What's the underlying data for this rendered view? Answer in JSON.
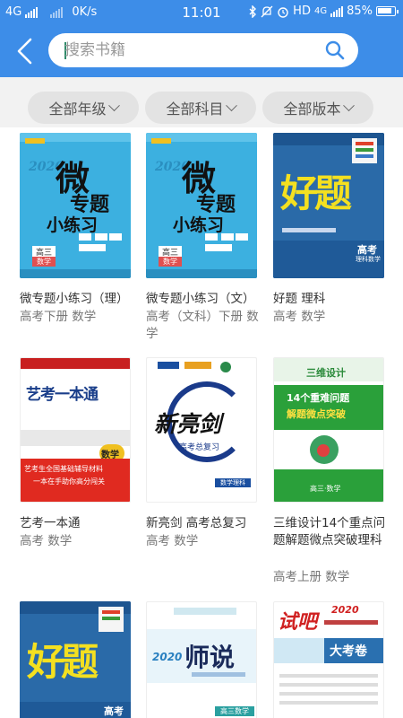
{
  "status_bar": {
    "network_left": "4G",
    "speed": "0K/s",
    "time": "11:01",
    "hd_label": "HD",
    "network_right": "4G",
    "battery": "85%"
  },
  "search": {
    "placeholder": "搜索书籍"
  },
  "filters": [
    {
      "label": "全部年级"
    },
    {
      "label": "全部科目"
    },
    {
      "label": "全部版本"
    }
  ],
  "books": [
    {
      "title": "微专题小练习（理）",
      "meta": "高考下册 数学"
    },
    {
      "title": "微专题小练习（文）",
      "meta": "高考（文科）下册 数学"
    },
    {
      "title": "好题 理科",
      "meta": "高考 数学"
    },
    {
      "title": "艺考一本通",
      "meta": "高考 数学"
    },
    {
      "title": "新亮剑 高考总复习",
      "meta": "高考 数学"
    },
    {
      "title": "三维设计14个重点问题解题微点突破理科",
      "meta": "高考上册 数学"
    }
  ],
  "covers": {
    "c1": {
      "main": "微",
      "sub": "专题",
      "small": "小练习",
      "year": "2020",
      "badge": "高三",
      "subject": "数学"
    },
    "c2": {
      "main": "微",
      "sub": "专题",
      "small": "小练习",
      "year": "2020",
      "badge": "高三",
      "subject": "数学"
    },
    "c3": {
      "main": "好题",
      "tag": "高考",
      "tag2": "理科数学"
    },
    "c4": {
      "main": "艺考一本通",
      "subject": "数学",
      "line1": "艺考生全国基础辅导材料",
      "line2": "一本在手助你高分闯关"
    },
    "c5": {
      "main": "新亮剑",
      "line1": "高考总复习",
      "tag": "数学理科"
    },
    "c6": {
      "top": "三维设计",
      "line1": "14个重难问题",
      "line2": "解题微点突破",
      "bottom": "高三·数学"
    },
    "c7": {
      "main": "好题",
      "tag": "高考"
    },
    "c8": {
      "main": "师说",
      "year": "2020",
      "tag": "高三数学"
    },
    "c9": {
      "main": "试吧",
      "year": "2020",
      "tag": "大考卷"
    }
  },
  "colors": {
    "header": "#3d8de8",
    "filter_bg": "#f2f2f2",
    "chip_bg": "#e3e3e3"
  }
}
